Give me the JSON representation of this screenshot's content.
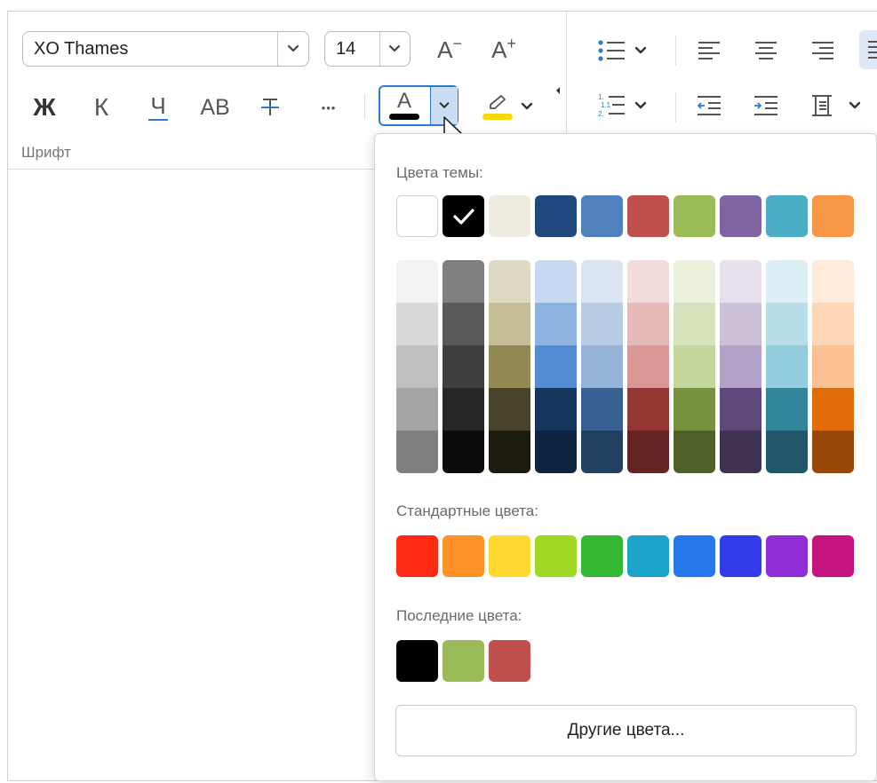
{
  "toolbar": {
    "font_name": "XO Thames",
    "font_size": "14",
    "grow_font_glyph": "A",
    "shrink_font_glyph": "A",
    "bold_glyph": "Ж",
    "italic_glyph": "К",
    "underline_glyph": "Ч",
    "caps_glyph": "АВ",
    "more_glyph": "•••",
    "font_color_glyph": "A",
    "group_label": "Шрифт",
    "colors": {
      "accent": "#2b7cd3",
      "font_color_bar": "#000000",
      "highlight_bar": "#f5d90a"
    }
  },
  "popup": {
    "theme_title": "Цвета темы:",
    "theme_colors": [
      "#ffffff",
      "#000000",
      "#eeece1",
      "#1f497d",
      "#4f81bd",
      "#c0504d",
      "#9bbb59",
      "#8064a2",
      "#4bacc6",
      "#f79646"
    ],
    "selected_index": 1,
    "shades": [
      [
        "#f2f2f2",
        "#d8d8d8",
        "#bfbfbf",
        "#a5a5a5",
        "#7f7f7f"
      ],
      [
        "#7f7f7f",
        "#595959",
        "#3f3f3f",
        "#262626",
        "#0c0c0c"
      ],
      [
        "#ddd9c3",
        "#c4bd97",
        "#938953",
        "#494429",
        "#1d1b10"
      ],
      [
        "#c6d9f0",
        "#8db3e2",
        "#548dd4",
        "#17365d",
        "#0f243e"
      ],
      [
        "#dbe5f1",
        "#b8cce4",
        "#95b3d7",
        "#366092",
        "#244061"
      ],
      [
        "#f2dcdb",
        "#e5b9b7",
        "#d99694",
        "#953734",
        "#632423"
      ],
      [
        "#ebf1dd",
        "#d7e3bc",
        "#c3d69b",
        "#76923c",
        "#4f6128"
      ],
      [
        "#e5e0ec",
        "#ccc1d9",
        "#b2a2c7",
        "#5f497a",
        "#3f3151"
      ],
      [
        "#dbeef3",
        "#b7dde8",
        "#92cddc",
        "#31859b",
        "#205867"
      ],
      [
        "#fdeada",
        "#fbd5b5",
        "#fac08f",
        "#e36c09",
        "#974806"
      ]
    ],
    "standard_title": "Стандартные цвета:",
    "standard_colors": [
      "#ff2a12",
      "#ff9226",
      "#ffd932",
      "#9fd926",
      "#35b935",
      "#1ca3c9",
      "#2677e9",
      "#323ce9",
      "#8f2ed6",
      "#c4147f"
    ],
    "recent_title": "Последние цвета:",
    "recent_colors": [
      "#000000",
      "#9bbb59",
      "#c0504d"
    ],
    "more_colors_label": "Другие цвета..."
  }
}
